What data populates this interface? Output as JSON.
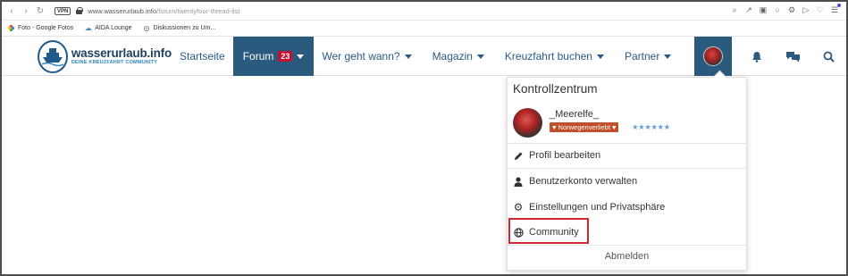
{
  "browser": {
    "vpn_label": "VPN",
    "url_host": "www.wasserurlaub.info",
    "url_path": "/forum/twentyfour-thread-list",
    "bookmarks": [
      {
        "label": "Foto - Google Fotos",
        "icon": "google-photos-icon"
      },
      {
        "label": "AIDA Lounge",
        "icon": "cloud-icon"
      },
      {
        "label": "Diskussionen zu Um...",
        "icon": "globe-icon"
      }
    ]
  },
  "site": {
    "logo_name": "wasserurlaub.info",
    "logo_tagline": "DEINE KREUZFAHRT COMMUNITY",
    "nav": {
      "home": "Startseite",
      "forum": "Forum",
      "forum_badge": "23",
      "wer_geht_wann": "Wer geht wann?",
      "magazin": "Magazin",
      "kreuzfahrt": "Kreuzfahrt buchen",
      "partner": "Partner"
    }
  },
  "panel": {
    "title": "Kontrollzentrum",
    "username": "_Meerelfe_",
    "rank": "♥ Norwegenverliebt ♥",
    "stars": "★★★★★★",
    "items": {
      "edit_profile": "Profil bearbeiten",
      "account": "Benutzerkonto verwalten",
      "settings": "Einstellungen und Privatsphäre",
      "community": "Community"
    },
    "logout": "Abmelden"
  },
  "colors": {
    "nav_active": "#2b5a7f",
    "badge": "#c8102e",
    "highlight": "#d22630",
    "rank_badge": "#c0502a"
  }
}
